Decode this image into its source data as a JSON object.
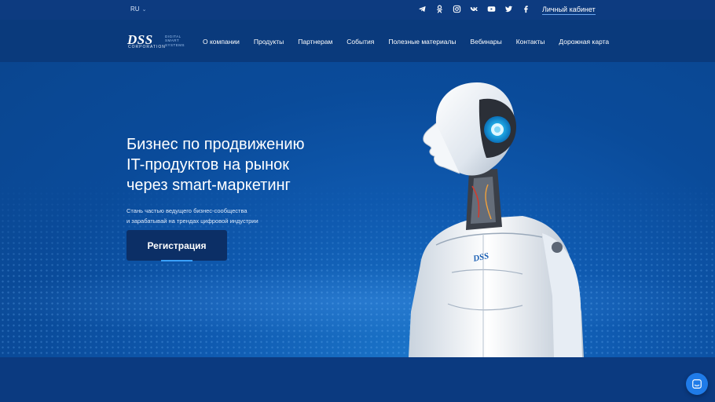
{
  "topbar": {
    "lang": "RU",
    "socials": [
      {
        "icon": "telegram-icon"
      },
      {
        "icon": "odnoklassniki-icon"
      },
      {
        "icon": "instagram-icon"
      },
      {
        "icon": "vk-icon"
      },
      {
        "icon": "youtube-icon"
      },
      {
        "icon": "twitter-icon"
      },
      {
        "icon": "facebook-icon"
      }
    ],
    "cabinet": "Личный кабинет"
  },
  "logo": {
    "mark": "DSS",
    "corp": "CORPORATION",
    "sub": "DIGITAL SMART SYSTEMS"
  },
  "nav": {
    "items": [
      "О компании",
      "Продукты",
      "Партнерам",
      "События",
      "Полезные материалы",
      "Вебинары",
      "Контакты",
      "Дорожная карта"
    ]
  },
  "hero": {
    "headline_1": "Бизнес по продвижению",
    "headline_2": "IT-продуктов на рынок",
    "headline_3": "через smart-маркетинг",
    "lead_1": "Стань частью ведущего бизнес-сообщества",
    "lead_2": "и зарабатывай на трендах цифровой индустрии",
    "button": "Регистрация",
    "robot_badge": "DSS"
  },
  "colors": {
    "page_bg": "#0d3f86",
    "nav_bg": "#0a3a7c",
    "button_bg": "#0c2f66",
    "accent": "#1f7be8"
  }
}
